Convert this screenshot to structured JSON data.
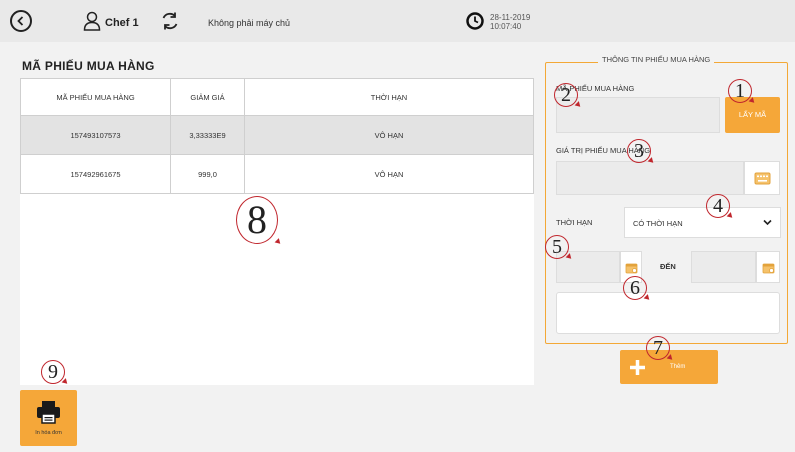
{
  "header": {
    "user_name": "Chef 1",
    "server_status": "Không phải máy chủ",
    "date": "28-11-2019",
    "time": "10:07:40"
  },
  "list": {
    "title": "MÃ PHIẾU MUA HÀNG",
    "columns": [
      "MÃ PHIẾU MUA HÀNG",
      "GIẢM GIÁ",
      "THỜI HẠN"
    ],
    "rows": [
      {
        "code": "157493107573",
        "discount": "3,33333E9",
        "term": "VÔ HẠN"
      },
      {
        "code": "157492961675",
        "discount": "999,0",
        "term": "VÔ HẠN"
      }
    ]
  },
  "form": {
    "title": "THÔNG TIN PHIẾU MUA HÀNG",
    "code_label": "MÃ PHIẾU MUA HÀNG",
    "code_value": "",
    "get_code_label": "LẤY MÃ",
    "value_label": "GIÁ TRỊ PHIẾU MUA HÀNG",
    "value_value": "",
    "term_label": "THỜI HẠN",
    "term_selected": "CÓ THỜI HẠN",
    "to_label": "ĐẾN",
    "add_label": "Thêm"
  },
  "footer": {
    "print_label": "In hóa đơn"
  },
  "markers": [
    "1",
    "2",
    "3",
    "4",
    "5",
    "6",
    "7",
    "8",
    "9"
  ],
  "colors": {
    "accent": "#f5a739",
    "marker_ring": "#c0262d",
    "topbar": "#e9e9e9"
  },
  "icons": [
    "back-icon",
    "user-icon",
    "sync-icon",
    "clock-icon",
    "keyboard-icon",
    "chevron-down-icon",
    "calendar-icon",
    "plus-icon",
    "printer-icon"
  ]
}
